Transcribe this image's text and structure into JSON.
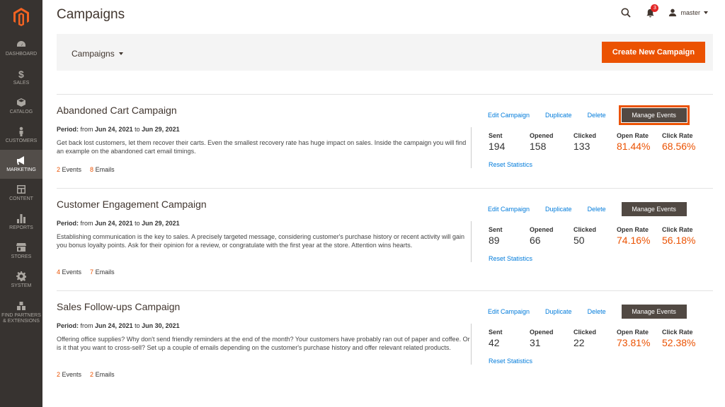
{
  "sidebar": {
    "items": [
      {
        "label": "DASHBOARD"
      },
      {
        "label": "SALES"
      },
      {
        "label": "CATALOG"
      },
      {
        "label": "CUSTOMERS"
      },
      {
        "label": "MARKETING"
      },
      {
        "label": "CONTENT"
      },
      {
        "label": "REPORTS"
      },
      {
        "label": "STORES"
      },
      {
        "label": "SYSTEM"
      },
      {
        "label": "FIND PARTNERS & EXTENSIONS"
      }
    ]
  },
  "header": {
    "title": "Campaigns",
    "notifications_count": "3",
    "user": "master"
  },
  "toolbar": {
    "switcher_label": "Campaigns",
    "create_label": "Create New Campaign"
  },
  "colors": {
    "accent": "#eb5202",
    "link": "#007bdb",
    "sidebar": "#373330"
  },
  "campaigns": [
    {
      "title": "Abandoned Cart Campaign",
      "period_label": "Period:",
      "from_word": "from",
      "from": "Jun 24, 2021",
      "to_word": "to",
      "to": "Jun 29, 2021",
      "description": "Get back lost customers, let them recover their carts. Even the smallest recovery rate has huge impact on sales. Inside the campaign you will find an example on the abandoned cart email timings.",
      "events_count": "2",
      "events_label": "Events",
      "emails_count": "8",
      "emails_label": "Emails",
      "edit": "Edit Campaign",
      "duplicate": "Duplicate",
      "delete": "Delete",
      "manage": "Manage Events",
      "sent_h": "Sent",
      "sent": "194",
      "opened_h": "Opened",
      "opened": "158",
      "clicked_h": "Clicked",
      "clicked": "133",
      "open_rate_h": "Open Rate",
      "open_rate": "81.44%",
      "click_rate_h": "Click Rate",
      "click_rate": "68.56%",
      "reset": "Reset Statistics"
    },
    {
      "title": "Customer Engagement Campaign",
      "period_label": "Period:",
      "from_word": "from",
      "from": "Jun 24, 2021",
      "to_word": "to",
      "to": "Jun 29, 2021",
      "description": "Establishing communication is the key to sales. A precisely targeted message, considering customer's purchase history or recent activity will gain you bonus loyalty points. Ask for their opinion for a review, or congratulate with the first year at the store. Attention wins hearts.",
      "events_count": "4",
      "events_label": "Events",
      "emails_count": "7",
      "emails_label": "Emails",
      "edit": "Edit Campaign",
      "duplicate": "Duplicate",
      "delete": "Delete",
      "manage": "Manage Events",
      "sent_h": "Sent",
      "sent": "89",
      "opened_h": "Opened",
      "opened": "66",
      "clicked_h": "Clicked",
      "clicked": "50",
      "open_rate_h": "Open Rate",
      "open_rate": "74.16%",
      "click_rate_h": "Click Rate",
      "click_rate": "56.18%",
      "reset": "Reset Statistics"
    },
    {
      "title": "Sales Follow-ups Campaign",
      "period_label": "Period:",
      "from_word": "from",
      "from": "Jun 24, 2021",
      "to_word": "to",
      "to": "Jun 30, 2021",
      "description": "Offering office supplies? Why don't send friendly reminders at the end of the month? Your customers have probably ran out of paper and coffee. Or is it that you want to cross-sell? Set up a couple of emails depending on the customer's purchase history and offer relevant related products.",
      "events_count": "2",
      "events_label": "Events",
      "emails_count": "2",
      "emails_label": "Emails",
      "edit": "Edit Campaign",
      "duplicate": "Duplicate",
      "delete": "Delete",
      "manage": "Manage Events",
      "sent_h": "Sent",
      "sent": "42",
      "opened_h": "Opened",
      "opened": "31",
      "clicked_h": "Clicked",
      "clicked": "22",
      "open_rate_h": "Open Rate",
      "open_rate": "73.81%",
      "click_rate_h": "Click Rate",
      "click_rate": "52.38%",
      "reset": "Reset Statistics"
    }
  ]
}
